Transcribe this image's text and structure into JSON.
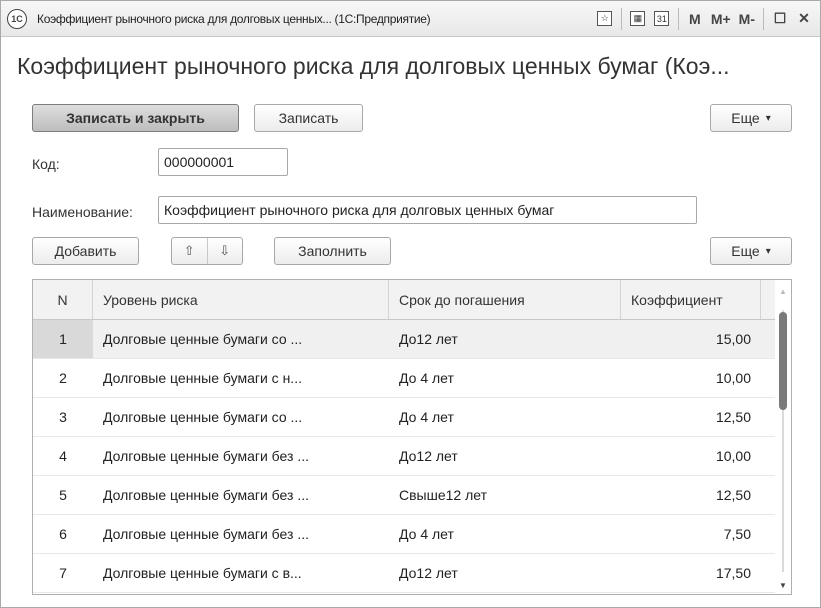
{
  "window": {
    "title": "Коэффициент рыночного риска для долговых ценных... (1С:Предприятие)",
    "app_icon": "1С",
    "controls": {
      "favorite_icon": "☆",
      "calc_icon": "▦",
      "calendar_icon": "31",
      "m": "M",
      "m_plus": "M+",
      "m_minus": "M-",
      "maximize": "☐",
      "close": "✕"
    }
  },
  "page": {
    "title": "Коэффициент рыночного риска для долговых ценных бумаг (Коэ..."
  },
  "toolbar": {
    "save_close": "Записать и закрыть",
    "save": "Записать",
    "more": "Еще"
  },
  "form": {
    "code_label": "Код:",
    "code_value": "000000001",
    "name_label": "Наименование:",
    "name_value": "Коэффициент рыночного риска для долговых ценных бумаг"
  },
  "table_toolbar": {
    "add": "Добавить",
    "up": "⇧",
    "down": "⇩",
    "fill": "Заполнить",
    "more": "Еще"
  },
  "table": {
    "columns": [
      "N",
      "Уровень риска",
      "Срок до погашения",
      "Коэффициент"
    ],
    "rows": [
      [
        "1",
        "Долговые ценные бумаги со ...",
        "До12 лет",
        "15,00"
      ],
      [
        "2",
        "Долговые ценные бумаги с н...",
        "До 4 лет",
        "10,00"
      ],
      [
        "3",
        "Долговые ценные бумаги со ...",
        "До 4 лет",
        "12,50"
      ],
      [
        "4",
        "Долговые ценные бумаги без ...",
        "До12 лет",
        "10,00"
      ],
      [
        "5",
        "Долговые ценные бумаги без ...",
        "Свыше12 лет",
        "12,50"
      ],
      [
        "6",
        "Долговые ценные бумаги без ...",
        "До 4 лет",
        "7,50"
      ],
      [
        "7",
        "Долговые ценные бумаги с в...",
        "До12 лет",
        "17,50"
      ]
    ],
    "selected_row": 0
  }
}
